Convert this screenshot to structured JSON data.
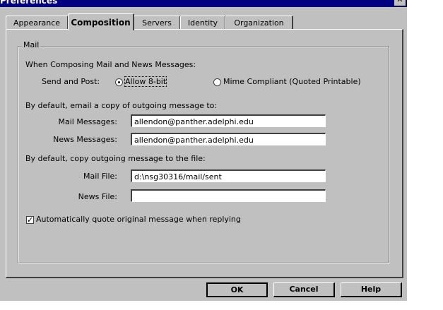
{
  "window": {
    "title": "Preferences"
  },
  "tabs": [
    {
      "label": "Appearance",
      "active": false
    },
    {
      "label": "Composition",
      "active": true
    },
    {
      "label": "Servers",
      "active": false
    },
    {
      "label": "Identity",
      "active": false
    },
    {
      "label": "Organization",
      "active": false
    }
  ],
  "mail_group": {
    "legend": "Mail",
    "compose_heading": "When Composing Mail and News Messages:",
    "send_post_label": "Send and Post:",
    "send_post_options": [
      {
        "label": "Allow 8-bit",
        "selected": true
      },
      {
        "label": "Mime Compliant (Quoted Printable)",
        "selected": false
      }
    ],
    "email_copy_heading": "By default, email a copy of outgoing message to:",
    "mail_messages_label": "Mail Messages:",
    "mail_messages_value": "allendon@panther.adelphi.edu",
    "news_messages_label": "News Messages:",
    "news_messages_value": "allendon@panther.adelphi.edu",
    "file_copy_heading": "By default, copy outgoing message to the file:",
    "mail_file_label": "Mail File:",
    "mail_file_value": "d:\\nsg30316/mail/sent",
    "news_file_label": "News File:",
    "news_file_value": "",
    "auto_quote_label": "Automatically quote original message when replying",
    "auto_quote_checked": true
  },
  "buttons": {
    "ok": "OK",
    "cancel": "Cancel",
    "help": "Help"
  }
}
